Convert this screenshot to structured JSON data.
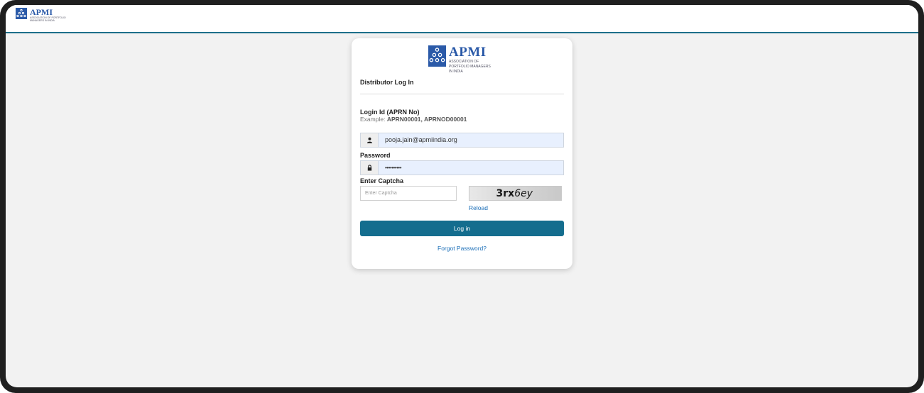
{
  "header": {
    "logo_title": "APMI",
    "logo_subtitle": "ASSOCIATION OF PORTFOLIO MANAGERS IN INDIA"
  },
  "card": {
    "logo_title": "APMI",
    "logo_line1": "ASSOCIATION OF",
    "logo_line2": "PORTFOLIO MANAGERS",
    "logo_line3": "IN INDIA",
    "heading": "Distributor Log In",
    "login_label": "Login Id (APRN No)",
    "example_prefix": "Example:",
    "example_value": "APRN00001, APRNOD00001",
    "login_value": "pooja.jain@apmiindia.org",
    "password_label": "Password",
    "password_value": "••••••••••",
    "captcha_label": "Enter Captcha",
    "captcha_placeholder": "Enter Captcha",
    "captcha_text_bold": "3rx",
    "captcha_text_italic": "6ey",
    "reload_label": "Reload",
    "login_button": "Log in",
    "forgot_link": "Forgot Password?"
  },
  "icons": {
    "user": "user-icon",
    "lock": "lock-icon"
  },
  "colors": {
    "brand_blue": "#2b5aa8",
    "button_teal": "#146d8e",
    "link_blue": "#1c6fb8",
    "input_fill": "#e8f0fe"
  }
}
